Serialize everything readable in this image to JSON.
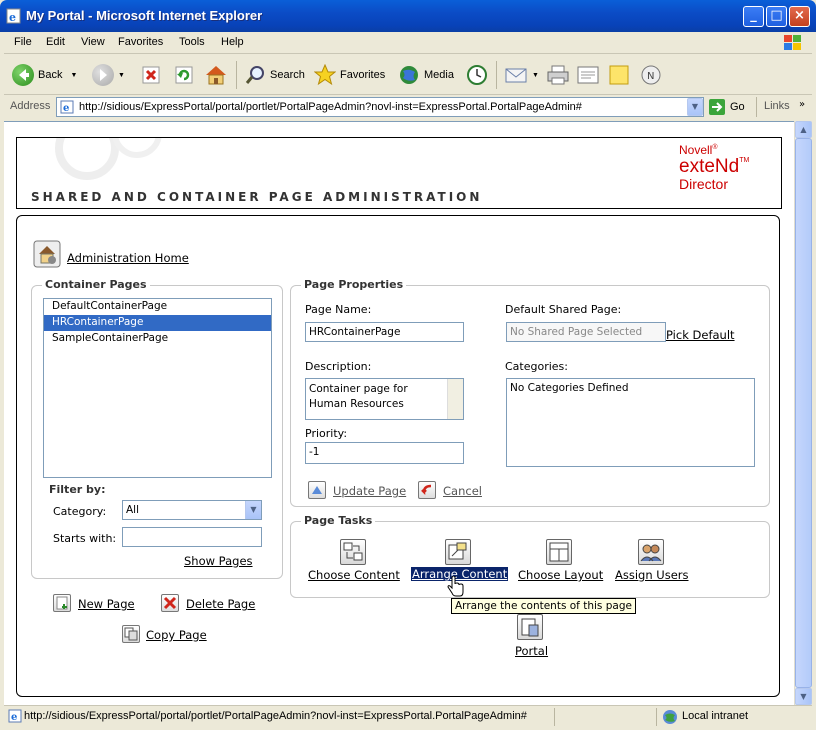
{
  "window": {
    "title": "My Portal - Microsoft Internet Explorer",
    "minimize": "_",
    "maximize": "□",
    "close": "×"
  },
  "menu": [
    "File",
    "Edit",
    "View",
    "Favorites",
    "Tools",
    "Help"
  ],
  "toolbar": {
    "back": "Back",
    "search": "Search",
    "favorites": "Favorites",
    "media": "Media"
  },
  "address": {
    "label": "Address",
    "url": "http://sidious/ExpressPortal/portal/portlet/PortalPageAdmin?novl-inst=ExpressPortal.PortalPageAdmin#",
    "go": "Go",
    "links": "Links"
  },
  "banner": {
    "brand_line1": "Novell",
    "brand_reg": "®",
    "brand_line2": "exteNd",
    "brand_tm": "TM",
    "brand_line3": "Director",
    "heading": "SHARED AND CONTAINER PAGE ADMINISTRATION"
  },
  "admin_home": "Administration Home",
  "container_pages": {
    "legend": "Container Pages",
    "items": [
      {
        "label": "DefaultContainerPage",
        "selected": false
      },
      {
        "label": "HRContainerPage",
        "selected": true
      },
      {
        "label": "SampleContainerPage",
        "selected": false
      }
    ],
    "filter_label": "Filter by:",
    "category_label": "Category:",
    "category_value": "All",
    "starts_with_label": "Starts with:",
    "starts_with_value": "",
    "show_pages": "Show Pages"
  },
  "actions": {
    "new_page": "New Page",
    "delete_page": "Delete Page",
    "copy_page": "Copy Page"
  },
  "page_properties": {
    "legend": "Page Properties",
    "page_name_label": "Page Name:",
    "page_name_value": "HRContainerPage",
    "default_shared_label": "Default Shared Page:",
    "default_shared_placeholder": "No Shared Page Selected",
    "pick_default": "Pick Default",
    "description_label": "Description:",
    "description_value": "Container page for Human Resources",
    "categories_label": "Categories:",
    "categories_value": "No Categories Defined",
    "priority_label": "Priority:",
    "priority_value": "-1",
    "update_page": "Update Page",
    "cancel": "Cancel"
  },
  "page_tasks": {
    "legend": "Page Tasks",
    "choose_content": "Choose Content",
    "arrange_content": "Arrange Content",
    "choose_layout": "Choose Layout",
    "assign_users": "Assign Users",
    "tooltip": "Arrange the contents of this page",
    "portal": "Portal"
  },
  "status": {
    "url": "http://sidious/ExpressPortal/portal/portlet/PortalPageAdmin?novl-inst=ExpressPortal.PortalPageAdmin#",
    "zone": "Local intranet"
  },
  "colors": {
    "titlebar": "#0a5fd8",
    "selection": "#316ac5",
    "brand_red": "#cc0000",
    "tooltip_bg": "#ffffe1"
  }
}
